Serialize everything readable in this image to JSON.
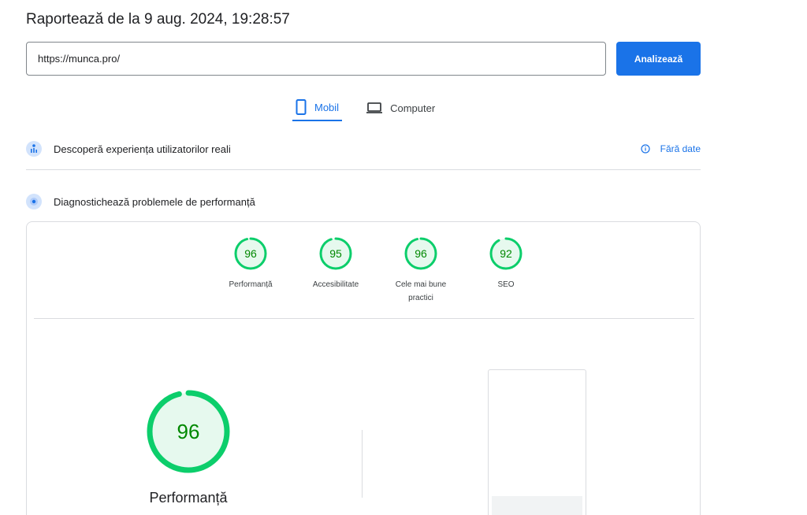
{
  "report": {
    "title": "Raportează de la 9 aug. 2024, 19:28:57"
  },
  "search": {
    "url_value": "https://munca.pro/",
    "analyze_label": "Analizează"
  },
  "device_tabs": [
    {
      "label": "Mobil",
      "active": true,
      "icon": "phone-icon"
    },
    {
      "label": "Computer",
      "active": false,
      "icon": "laptop-icon"
    }
  ],
  "field_data": {
    "label": "Descoperă experiența utilizatorilor reali",
    "no_data_label": "Fără date"
  },
  "lab_data": {
    "label": "Diagnostichează problemele de performanță"
  },
  "scores": [
    {
      "value": 96,
      "label": "Performanță"
    },
    {
      "value": 95,
      "label": "Accesibilitate"
    },
    {
      "value": 96,
      "label": "Cele mai bune practici"
    },
    {
      "value": 92,
      "label": "SEO"
    }
  ],
  "main_score": {
    "value": "96",
    "label": "Performanță"
  },
  "colors": {
    "accent": "#1a73e8",
    "pass_green": "#0cce6b",
    "pass_text": "#008800",
    "pass_fill": "#e6f9ee"
  }
}
